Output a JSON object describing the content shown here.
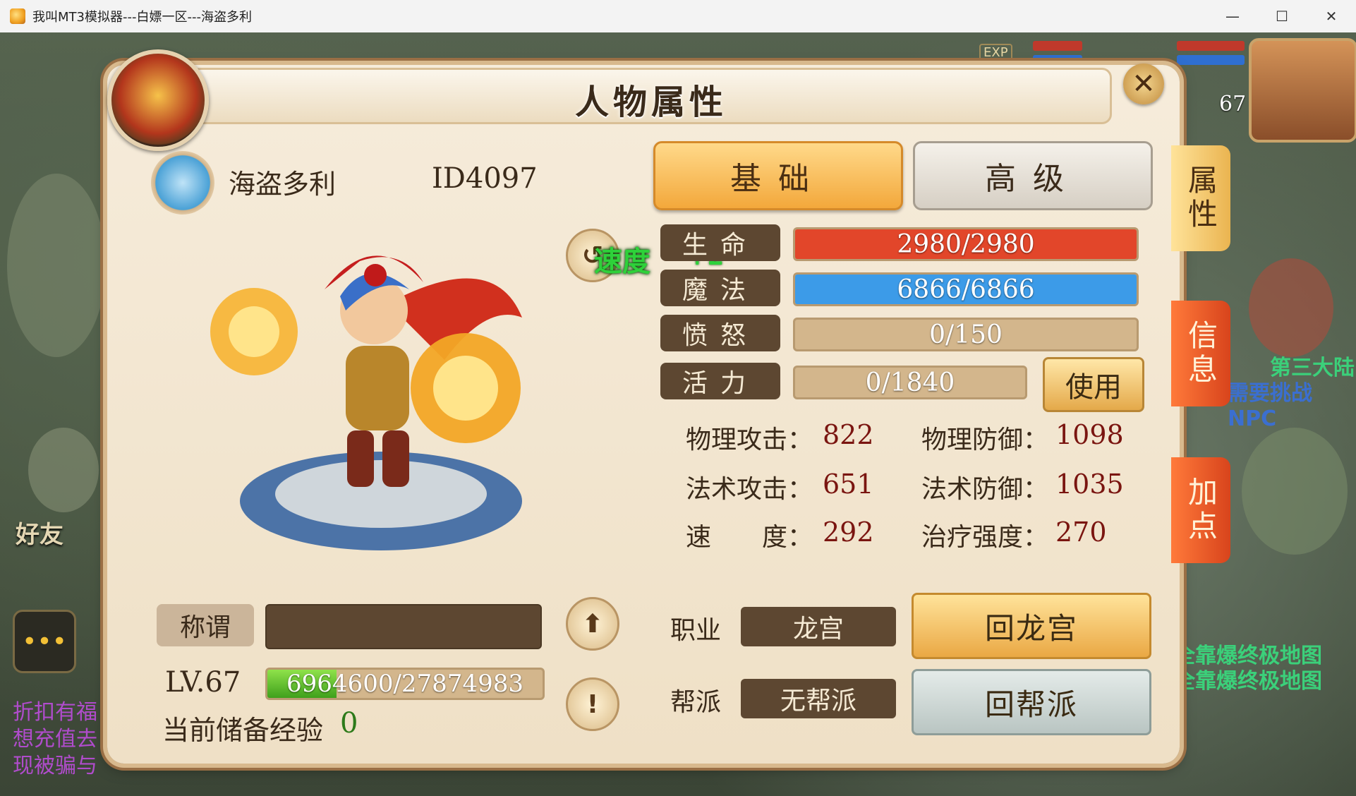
{
  "window": {
    "title": "我叫MT3模拟器---白嫖一区---海盗多利",
    "minimize": "—",
    "maximize": "☐",
    "close": "✕"
  },
  "panel": {
    "title": "人物属性",
    "close_icon": "✕"
  },
  "character": {
    "name": "海盗多利",
    "id": "ID4097",
    "speed_float": "速度",
    "speed_plus": "+2"
  },
  "tabs": {
    "basic": "基础",
    "advanced": "高级"
  },
  "stats": {
    "hp": {
      "label": "生命",
      "value": "2980/2980",
      "fraction": 1.0,
      "color": "#e2462a"
    },
    "mp": {
      "label": "魔法",
      "value": "6866/6866",
      "fraction": 1.0,
      "color": "#3c9be8"
    },
    "rage": {
      "label": "愤怒",
      "value": "0/150",
      "fraction": 0.0,
      "color": "#d3b68c"
    },
    "vigor": {
      "label": "活力",
      "value": "0/1840",
      "fraction": 0.0,
      "color": "#d3b68c"
    },
    "use_button": "使用"
  },
  "attributes": {
    "phys_atk_label": "物理攻击：",
    "phys_atk": "822",
    "phys_def_label": "物理防御：",
    "phys_def": "1098",
    "mag_atk_label": "法术攻击：",
    "mag_atk": "651",
    "mag_def_label": "法术防御：",
    "mag_def": "1035",
    "speed_label": "速　　度：",
    "speed": "292",
    "heal_label": "治疗强度：",
    "heal": "270"
  },
  "bottom_left": {
    "title_label": "称谓",
    "title_value": "",
    "level": "LV.67",
    "exp_text": "6964600/27874983",
    "exp_fraction": 0.25,
    "reserve_label": "当前储备经验",
    "reserve_value": "0"
  },
  "bottom_right": {
    "job_label": "职业",
    "job_value": "龙宫",
    "guild_label": "帮派",
    "guild_value": "无帮派",
    "return_home": "回龙宫",
    "return_guild": "回帮派"
  },
  "side_tabs": {
    "attr": "属性",
    "info": "信息",
    "points": "加点"
  },
  "hud": {
    "level": "67",
    "exp_tag": "EXP",
    "friends": "好友",
    "chat_lines": [
      "折扣有福",
      "想充值去",
      "现被骗与"
    ],
    "right_text1": "第三大陆",
    "right_text2": "需要挑战NPC",
    "right_text3": "全靠爆终极地图",
    "right_text4": "全靠爆终极地图"
  }
}
